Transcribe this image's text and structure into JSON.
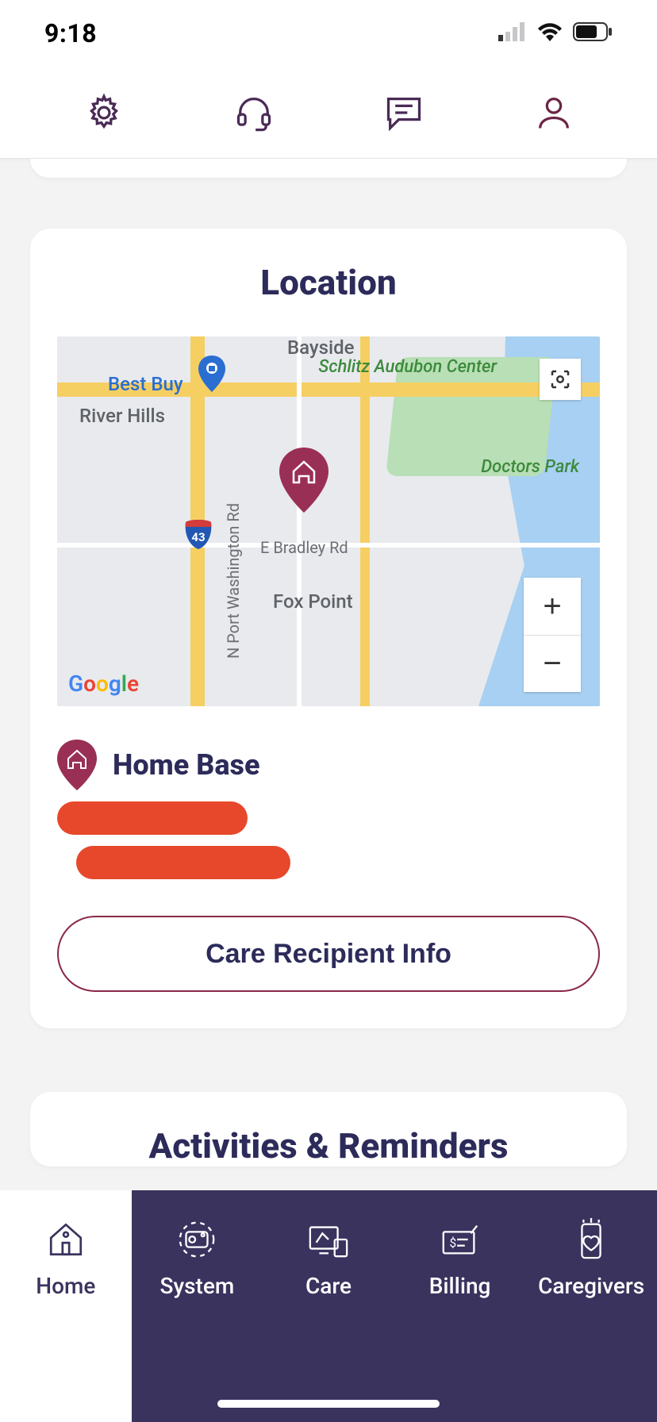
{
  "status": {
    "time": "9:18"
  },
  "toolbar_icons": {
    "settings": "settings-icon",
    "support": "headset-icon",
    "chat": "chat-icon",
    "profile": "profile-icon"
  },
  "location_card": {
    "title": "Location",
    "home_base_label": "Home Base",
    "button_label": "Care Recipient Info",
    "map": {
      "attribution": "Google",
      "labels": {
        "bayside": "Bayside",
        "best_buy": "Best Buy",
        "river_hills": "River Hills",
        "schlitz": "Schlitz Audubon Center",
        "doctors_park": "Doctors Park",
        "e_bradley": "E Bradley Rd",
        "fox_point": "Fox Point",
        "n_port": "N Port Washington Rd",
        "interstate": "43"
      }
    }
  },
  "activities_card": {
    "title": "Activities & Reminders"
  },
  "nav": {
    "items": [
      {
        "label": "Home",
        "active": true
      },
      {
        "label": "System",
        "active": false
      },
      {
        "label": "Care",
        "active": false
      },
      {
        "label": "Billing",
        "active": false
      },
      {
        "label": "Caregivers",
        "active": false
      }
    ]
  }
}
